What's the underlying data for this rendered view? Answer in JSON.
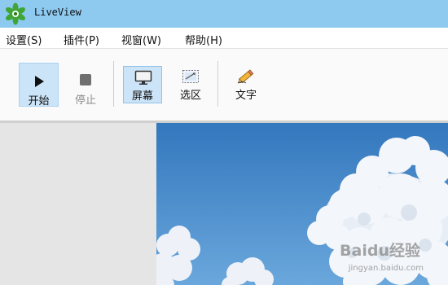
{
  "window": {
    "title": "LiveView",
    "icon": "green-star-icon",
    "title_bar_color": "#8ec9f0"
  },
  "menu": {
    "items": [
      {
        "label": "设置(S)"
      },
      {
        "label": "插件(P)"
      },
      {
        "label": "视窗(W)"
      },
      {
        "label": "帮助(H)"
      }
    ]
  },
  "toolbar": {
    "start": {
      "label": "开始",
      "icon": "play-icon",
      "active": true
    },
    "stop": {
      "label": "停止",
      "icon": "stop-icon",
      "enabled": false
    },
    "screen": {
      "label": "屏幕",
      "icon": "monitor-icon",
      "selected": true
    },
    "region": {
      "label": "选区",
      "icon": "region-select-icon"
    },
    "text": {
      "label": "文字",
      "icon": "pencil-icon"
    },
    "highlight_color": "#cce4f7"
  },
  "preview": {
    "sky_color": "#3d86c6",
    "watermark": "Baidu经验",
    "watermark_url": "jingyan.baidu.com"
  }
}
